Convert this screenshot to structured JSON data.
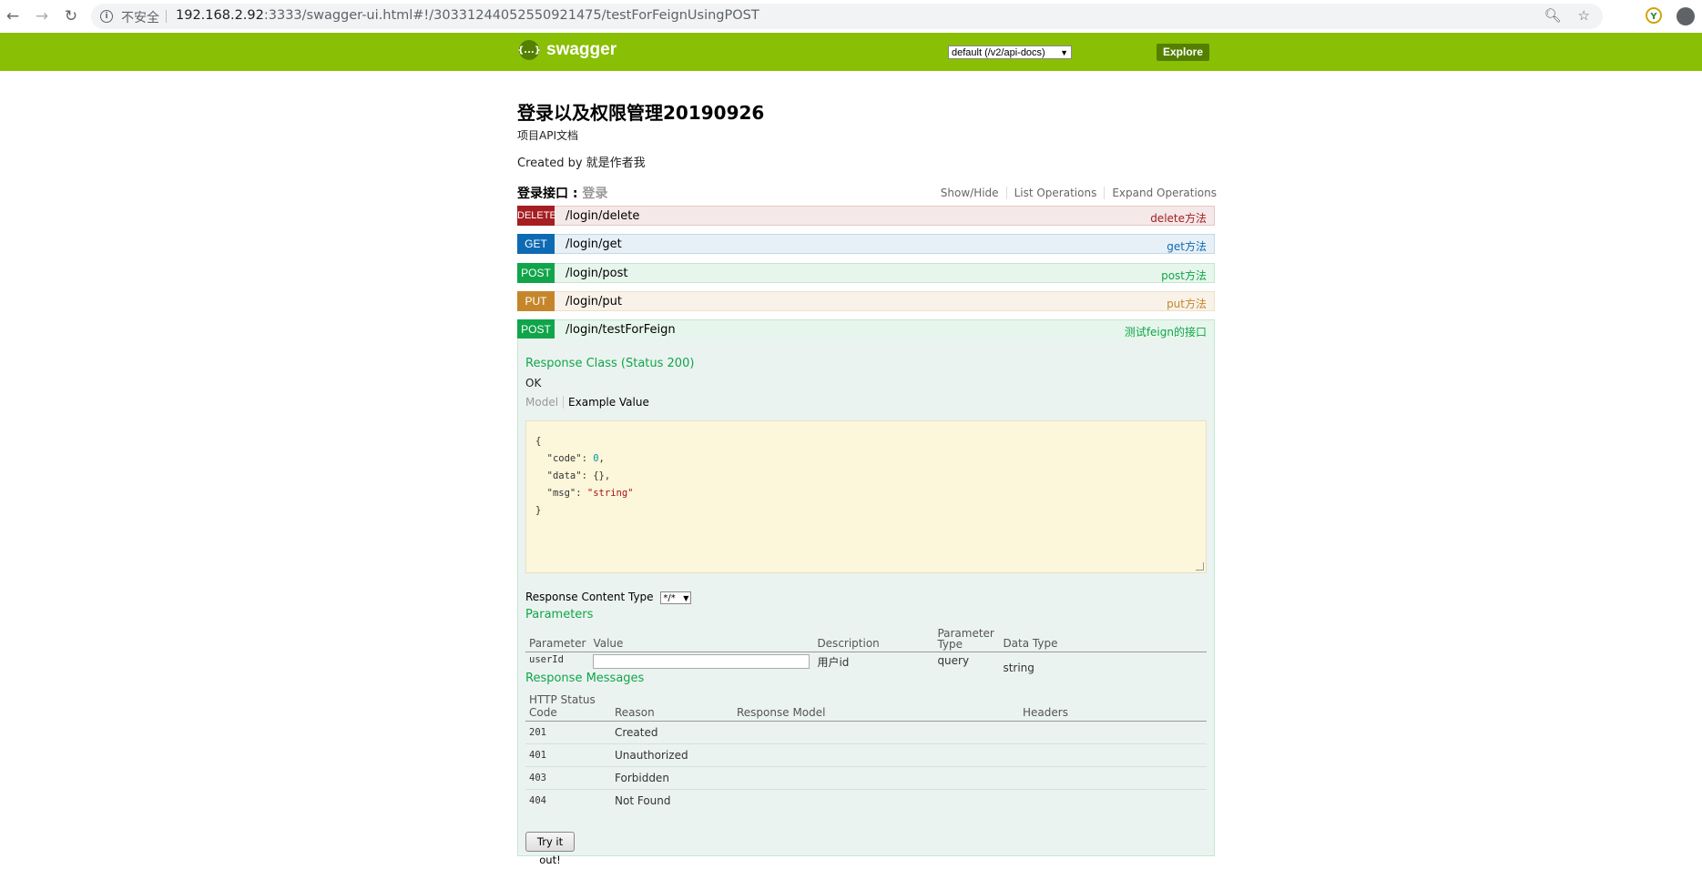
{
  "browser": {
    "insecure_label": "不安全",
    "url_host": "192.168.2.92",
    "url_rest": ":3333/swagger-ui.html#!/30331244052550921475/testForFeignUsingPOST",
    "icons": [
      "back-icon",
      "forward-icon",
      "reload-icon",
      "info-icon",
      "zoom-icon",
      "star-icon",
      "extension-icon",
      "profile-icon"
    ]
  },
  "header": {
    "logo_text": "swagger",
    "logo_badge": "{...}",
    "spec_select": "default (/v2/api-docs)",
    "explore_label": "Explore",
    "colors": {
      "bar": "#89bf04",
      "explore": "#547f00"
    }
  },
  "info": {
    "title": "登录以及权限管理20190926",
    "description": "项目API文档",
    "created_by": "Created by 就是作者我"
  },
  "section": {
    "name": "登录接口",
    "separator": " : ",
    "subtitle": "登录",
    "links": [
      "Show/Hide",
      "List Operations",
      "Expand Operations"
    ]
  },
  "operations": [
    {
      "method": "DELETE",
      "path": "/login/delete",
      "summary": "delete方法",
      "color": "#a41e22"
    },
    {
      "method": "GET",
      "path": "/login/get",
      "summary": "get方法",
      "color": "#0f6ab4"
    },
    {
      "method": "POST",
      "path": "/login/post",
      "summary": "post方法",
      "color": "#10a54a"
    },
    {
      "method": "PUT",
      "path": "/login/put",
      "summary": "put方法",
      "color": "#c5862b"
    },
    {
      "method": "POST",
      "path": "/login/testForFeign",
      "summary": "测试feign的接口",
      "color": "#10a54a"
    }
  ],
  "expanded": {
    "response_class_heading": "Response Class (Status 200)",
    "response_class_value": "OK",
    "tab_model": "Model",
    "tab_example": "Example Value",
    "example_lines": [
      "{",
      "  \"code\": ",
      "0",
      ",",
      "  \"data\": {},",
      "  \"msg\": ",
      "\"string\"",
      "}"
    ],
    "response_content_type_label": "Response Content Type",
    "response_content_type_value": "*/*",
    "parameters_heading": "Parameters",
    "param_headers": [
      "Parameter",
      "Value",
      "Description",
      "Parameter Type",
      "Data Type"
    ],
    "params": [
      {
        "name": "userId",
        "value": "",
        "description": "用户id",
        "type": "query",
        "data_type": "string"
      }
    ],
    "response_messages_heading": "Response Messages",
    "response_headers": [
      "HTTP Status Code",
      "Reason",
      "Response Model",
      "Headers"
    ],
    "responses": [
      {
        "code": "201",
        "reason": "Created"
      },
      {
        "code": "401",
        "reason": "Unauthorized"
      },
      {
        "code": "403",
        "reason": "Forbidden"
      },
      {
        "code": "404",
        "reason": "Not Found"
      }
    ],
    "try_label": "Try it out!"
  }
}
